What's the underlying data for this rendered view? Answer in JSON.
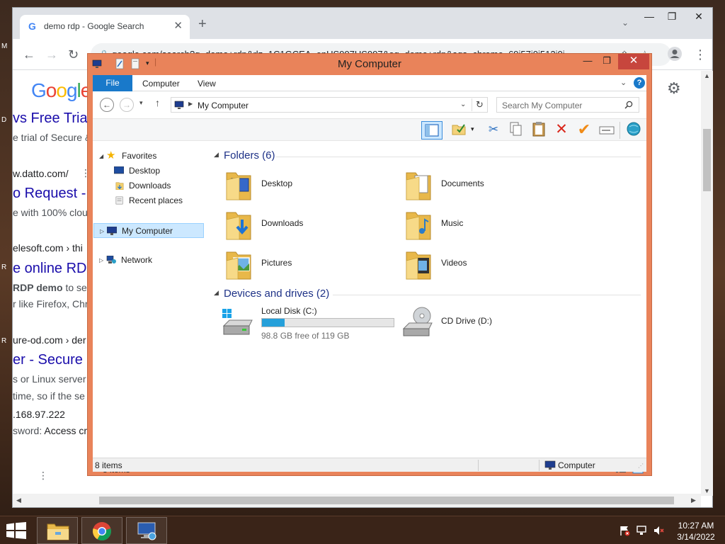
{
  "browser": {
    "tab_title": "demo rdp - Google Search",
    "tab_favicon": "G",
    "url": "google.com/search?q=demo+rdp&rlz=1C1GCEA_enUS997US997&oq=demo+rdp&aqs=chrome..69i57j0i512j0i..."
  },
  "google_page": {
    "logo": "Google",
    "results": [
      {
        "title": "vs Free Trial",
        "snippet": "e trial of Secure &"
      },
      {
        "url": "w.datto.com/",
        "title": "o Request -",
        "snippet": "e with 100% clou"
      },
      {
        "url": "elesoft.com › thi",
        "title": "e online RDP",
        "snippet_bold": "RDP demo",
        "snippet_rest": "to se",
        "snippet2": "r like Firefox, Chr"
      },
      {
        "url": "ure-od.com › der",
        "title": "er - Secure",
        "snippet": "s or Linux server",
        "snippet2": "time, so if the se",
        "ip": ".168.97.222",
        "password_label": "sword:",
        "password_rest": "Access cre"
      }
    ]
  },
  "desktop_edge_labels": [
    "M",
    "D",
    "R",
    "R"
  ],
  "explorer": {
    "title": "My Computer",
    "ribbon_tabs": {
      "file": "File",
      "computer": "Computer",
      "view": "View"
    },
    "address": "My Computer",
    "search_placeholder": "Search My Computer",
    "nav": {
      "favorites": "Favorites",
      "desktop": "Desktop",
      "downloads": "Downloads",
      "recent": "Recent places",
      "my_computer": "My Computer",
      "network": "Network"
    },
    "folders_header": "Folders (6)",
    "folders": [
      {
        "name": "Desktop",
        "icon": "desktop-folder-icon"
      },
      {
        "name": "Documents",
        "icon": "documents-folder-icon"
      },
      {
        "name": "Downloads",
        "icon": "downloads-folder-icon"
      },
      {
        "name": "Music",
        "icon": "music-folder-icon"
      },
      {
        "name": "Pictures",
        "icon": "pictures-folder-icon"
      },
      {
        "name": "Videos",
        "icon": "videos-folder-icon"
      }
    ],
    "drives_header": "Devices and drives (2)",
    "drives": [
      {
        "name": "Local Disk (C:)",
        "free_text": "98.8 GB free of 119 GB",
        "used_fraction": 0.17
      },
      {
        "name": "CD Drive (D:)"
      }
    ],
    "status_count": "8 items",
    "status_bar_count": "8 items",
    "status_bar_location": "Computer"
  },
  "taskbar": {
    "time": "10:27 AM",
    "date": "3/14/2022"
  },
  "colors": {
    "explorer_frame": "#e9835a",
    "accent_blue": "#1979ca",
    "close_red": "#c7463d",
    "link_blue": "#1a0dab"
  }
}
